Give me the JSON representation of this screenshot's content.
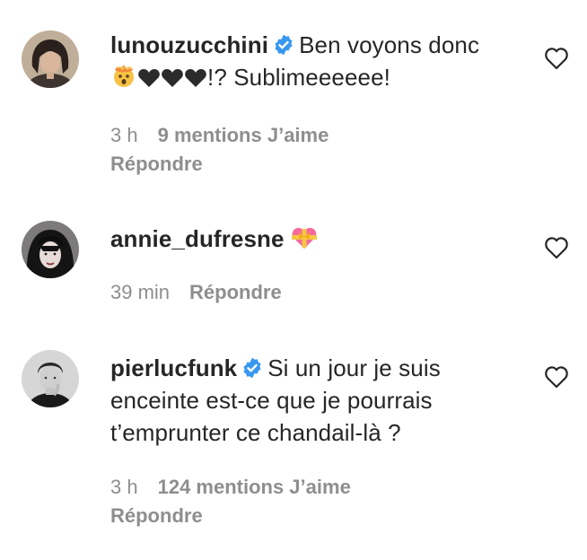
{
  "comments": [
    {
      "username": "lunouzucchini",
      "verified": true,
      "text_line1": "Ben voyons donc",
      "text_line2_suffix": "!? Sublimeeeeee!",
      "time": "3 h",
      "likes": "9 mentions J’aime",
      "reply": "Répondre"
    },
    {
      "username": "annie_dufresne",
      "verified": false,
      "time": "39 min",
      "reply": "Répondre"
    },
    {
      "username": "pierlucfunk",
      "verified": true,
      "text_line1": "Si un jour je suis",
      "text_line2": "enceinte est-ce que je pourrais",
      "text_line3": "t’emprunter ce chandail-là ?",
      "time": "3 h",
      "likes": "124 mentions J’aime",
      "reply": "Répondre"
    }
  ],
  "colors": {
    "text": "#262626",
    "secondary": "#8e8e8e",
    "verified": "#3897f0"
  },
  "icons": {
    "like": "heart-outline-icon",
    "verified": "verified-badge-icon"
  }
}
